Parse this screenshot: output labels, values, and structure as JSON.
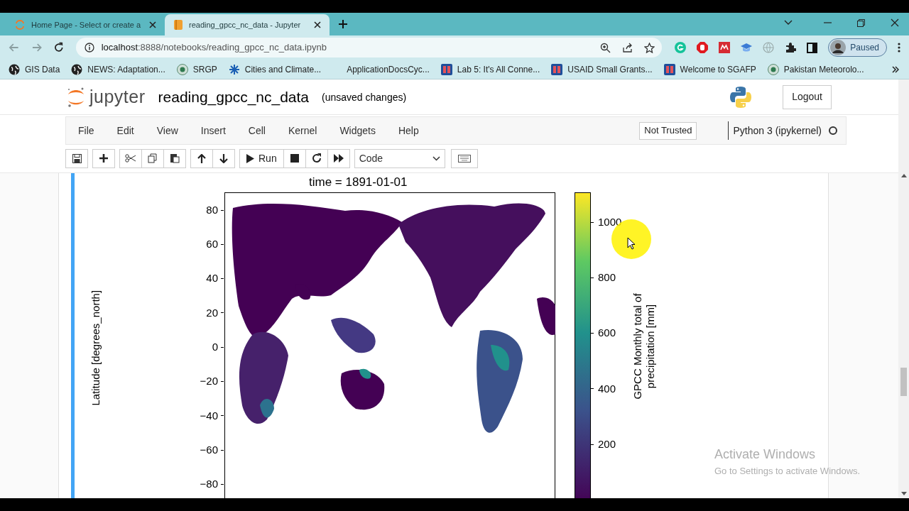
{
  "browser": {
    "tabs": [
      {
        "title": "Home Page - Select or create a",
        "selected": false
      },
      {
        "title": "reading_gpcc_nc_data - Jupyter",
        "selected": true
      }
    ],
    "address_host": "localhost",
    "address_path": ":8888/notebooks/reading_gpcc_nc_data.ipynb",
    "profile_label": "Paused",
    "bookmarks": [
      {
        "label": "GIS Data",
        "kind": "globe"
      },
      {
        "label": "NEWS: Adaptation...",
        "kind": "globe"
      },
      {
        "label": "SRGP",
        "kind": "round"
      },
      {
        "label": "Cities and Climate...",
        "kind": "star"
      },
      {
        "label": "ApplicationDocsCyc...",
        "kind": "plain"
      },
      {
        "label": "Lab 5: It's All Conne...",
        "kind": "square"
      },
      {
        "label": "USAID Small Grants...",
        "kind": "square"
      },
      {
        "label": "Welcome to SGAFP",
        "kind": "square"
      },
      {
        "label": "Pakistan Meteorolo...",
        "kind": "round"
      }
    ]
  },
  "notebook": {
    "logo_text": "jupyter",
    "title": "reading_gpcc_nc_data",
    "save_status": "(unsaved changes)",
    "logout": "Logout",
    "menu": [
      "File",
      "Edit",
      "View",
      "Insert",
      "Cell",
      "Kernel",
      "Widgets",
      "Help"
    ],
    "trust": "Not Trusted",
    "kernel": "Python 3 (ipykernel)",
    "kernel_busy": false,
    "run_label": "Run",
    "cell_type": "Code"
  },
  "output_plot": {
    "title": "time = 1891-01-01",
    "ylabel": "Latitude [degrees_north]",
    "yticks": [
      "80",
      "60",
      "40",
      "20",
      "0",
      "−20",
      "−40",
      "−60",
      "−80"
    ],
    "colorbar_ticks": [
      "1000",
      "800",
      "600",
      "400",
      "200"
    ],
    "colorbar_label_lines": [
      "GPCC Monthly total of",
      "precipitation [mm]"
    ]
  },
  "os_notice": {
    "title": "Activate Windows",
    "text": "Go to Settings to activate Windows."
  }
}
